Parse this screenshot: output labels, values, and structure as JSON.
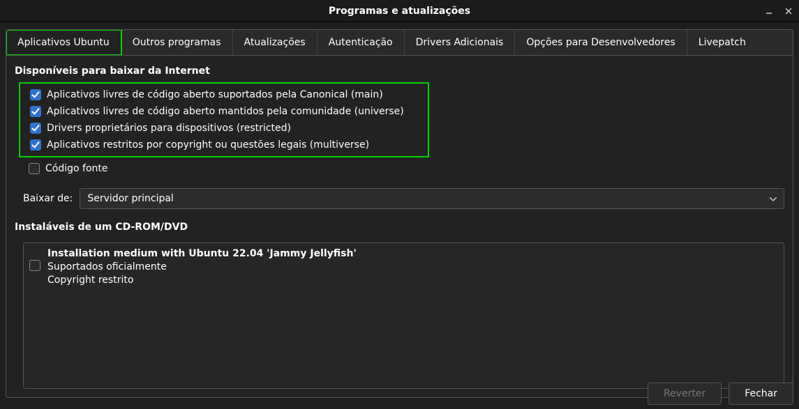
{
  "window": {
    "title": "Programas e atualizações"
  },
  "tabs": [
    {
      "label": "Aplicativos Ubuntu",
      "active": true
    },
    {
      "label": "Outros programas"
    },
    {
      "label": "Atualizações"
    },
    {
      "label": "Autenticação"
    },
    {
      "label": "Drivers Adicionais"
    },
    {
      "label": "Opções para Desenvolvedores"
    },
    {
      "label": "Livepatch"
    }
  ],
  "internet": {
    "heading": "Disponíveis para baixar da Internet",
    "items": [
      {
        "label": "Aplicativos livres de código aberto suportados pela Canonical (main)",
        "checked": true
      },
      {
        "label": "Aplicativos livres de código aberto mantidos pela comunidade (universe)",
        "checked": true
      },
      {
        "label": "Drivers proprietários para dispositivos (restricted)",
        "checked": true
      },
      {
        "label": "Aplicativos restritos por copyright ou questões legais (multiverse)",
        "checked": true
      }
    ],
    "source_code": {
      "label": "Código fonte",
      "checked": false
    }
  },
  "download": {
    "label": "Baixar de:",
    "selected": "Servidor principal"
  },
  "cdrom": {
    "heading": "Instaláveis de um CD-ROM/DVD",
    "item": {
      "checked": false,
      "title": "Installation medium with Ubuntu 22.04 'Jammy Jellyfish'",
      "line2": "Suportados oficialmente",
      "line3": "Copyright restrito"
    }
  },
  "buttons": {
    "revert": "Reverter",
    "close": "Fechar"
  }
}
